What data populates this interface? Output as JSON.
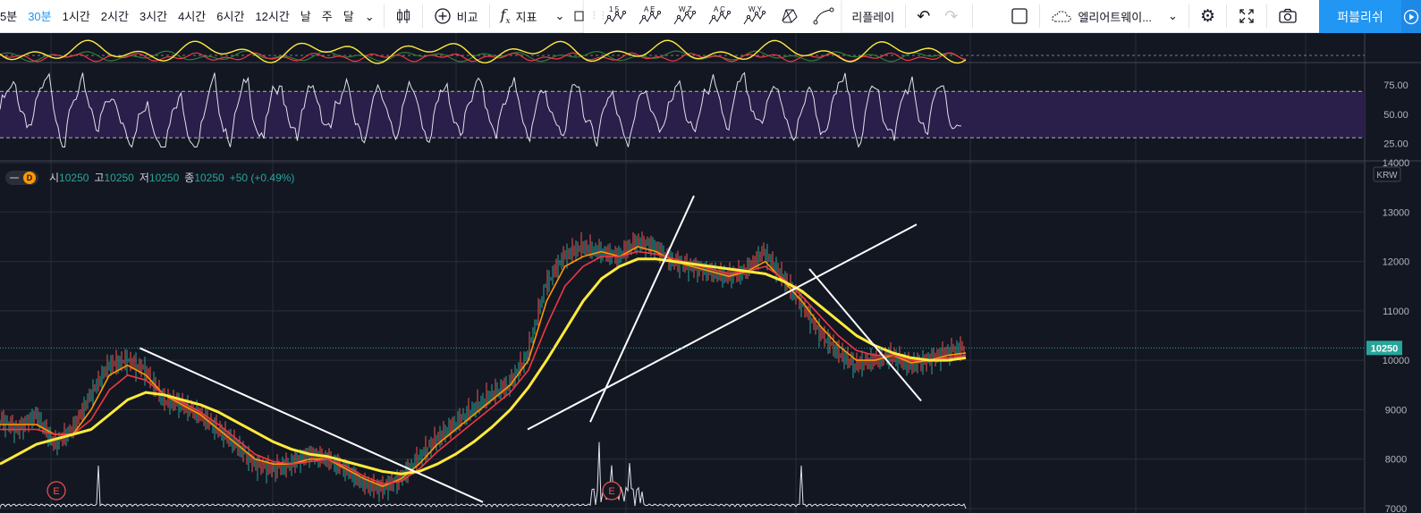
{
  "toolbar": {
    "intervals": [
      {
        "label": "5분",
        "active": false
      },
      {
        "label": "30분",
        "active": true
      },
      {
        "label": "1시간",
        "active": false
      },
      {
        "label": "2시간",
        "active": false
      },
      {
        "label": "3시간",
        "active": false
      },
      {
        "label": "4시간",
        "active": false
      },
      {
        "label": "6시간",
        "active": false
      },
      {
        "label": "12시간",
        "active": false
      },
      {
        "label": "날",
        "active": false
      },
      {
        "label": "주",
        "active": false
      },
      {
        "label": "달",
        "active": false
      }
    ],
    "compare_label": "비교",
    "indicators_label": "지표",
    "patterns": [
      {
        "top": "1 5",
        "icon": "wave-pattern-icon"
      },
      {
        "top": "A E",
        "icon": "wave-pattern-icon"
      },
      {
        "top": "W Z",
        "icon": "wave-pattern-icon"
      },
      {
        "top": "A C",
        "icon": "wave-pattern-icon"
      },
      {
        "top": "W Y",
        "icon": "wave-pattern-icon"
      }
    ],
    "replay_label": "리플레이",
    "layout_name": "엘리어트웨이...",
    "publish_label": "퍼블리쉬"
  },
  "legend": {
    "badge": "D",
    "o_label": "시",
    "o_value": "10250",
    "h_label": "고",
    "h_value": "10250",
    "l_label": "저",
    "l_value": "10250",
    "c_label": "종",
    "c_value": "10250",
    "change": "+50 (+0.49%)"
  },
  "rsi": {
    "axis": [
      "75.00",
      "50.00",
      "25.00"
    ],
    "band_color": "#2a1e4a"
  },
  "price_axis": {
    "ticks": [
      "14000",
      "13000",
      "12000",
      "11000",
      "10000",
      "9000",
      "8000",
      "7000"
    ],
    "currency": "KRW",
    "last_price": "10250",
    "last_price_color": "#26a69a"
  },
  "events": [
    "E",
    "E"
  ],
  "colors": {
    "ma_fast": "#ff9800",
    "ma_mid": "#f23645",
    "ma_slow": "#ffeb3b",
    "trendline": "#ffffff",
    "up": "#26a69a",
    "down": "#ef5350",
    "accent": "#2196f3"
  },
  "chart_data": {
    "type": "line",
    "interval": "30분",
    "currency": "KRW",
    "ylim": [
      7000,
      14000
    ],
    "price_path": [
      8800,
      8600,
      8900,
      8300,
      8600,
      9300,
      9900,
      10000,
      9800,
      9200,
      9100,
      8900,
      8600,
      8300,
      7900,
      7800,
      7900,
      8100,
      8000,
      7800,
      7500,
      7400,
      7600,
      8000,
      8400,
      8700,
      9000,
      9300,
      9500,
      10100,
      11500,
      12100,
      12300,
      12200,
      12100,
      12400,
      12300,
      12000,
      11900,
      11800,
      11700,
      11800,
      12200,
      11700,
      11200,
      10600,
      10200,
      9900,
      10000,
      10100,
      9900,
      10000,
      10150,
      10250
    ],
    "moving_averages": [
      {
        "color": "#ff9800",
        "values": [
          8700,
          8700,
          8700,
          8500,
          8500,
          9000,
          9700,
          9900,
          9700,
          9300,
          9100,
          8900,
          8600,
          8300,
          8000,
          7900,
          7900,
          8000,
          8000,
          7800,
          7600,
          7450,
          7600,
          7900,
          8300,
          8600,
          8900,
          9200,
          9500,
          10000,
          11200,
          11900,
          12100,
          12200,
          12100,
          12300,
          12200,
          12000,
          11900,
          11800,
          11700,
          11800,
          12000,
          11600,
          11200,
          10700,
          10300,
          10000,
          10000,
          10100,
          9950,
          10000,
          10100,
          10150
        ]
      },
      {
        "color": "#f23645",
        "values": [
          8600,
          8600,
          8600,
          8500,
          8500,
          8800,
          9400,
          9700,
          9600,
          9300,
          9150,
          8950,
          8700,
          8400,
          8100,
          7950,
          7900,
          7950,
          8000,
          7850,
          7650,
          7500,
          7550,
          7800,
          8150,
          8450,
          8750,
          9050,
          9350,
          9800,
          10700,
          11500,
          11900,
          12100,
          12100,
          12200,
          12150,
          12050,
          11950,
          11850,
          11750,
          11800,
          11900,
          11650,
          11300,
          10900,
          10500,
          10200,
          10100,
          10100,
          10000,
          10000,
          10050,
          10100
        ]
      },
      {
        "color": "#ffeb3b",
        "values": [
          7900,
          8100,
          8300,
          8400,
          8500,
          8600,
          8900,
          9200,
          9350,
          9300,
          9200,
          9100,
          8950,
          8750,
          8550,
          8350,
          8200,
          8100,
          8050,
          7950,
          7850,
          7750,
          7700,
          7750,
          7900,
          8100,
          8350,
          8650,
          9000,
          9450,
          10000,
          10600,
          11200,
          11650,
          11900,
          12050,
          12050,
          12000,
          11950,
          11900,
          11850,
          11800,
          11750,
          11600,
          11400,
          11100,
          10800,
          10500,
          10300,
          10150,
          10050,
          10000,
          10000,
          10050
        ]
      }
    ]
  }
}
